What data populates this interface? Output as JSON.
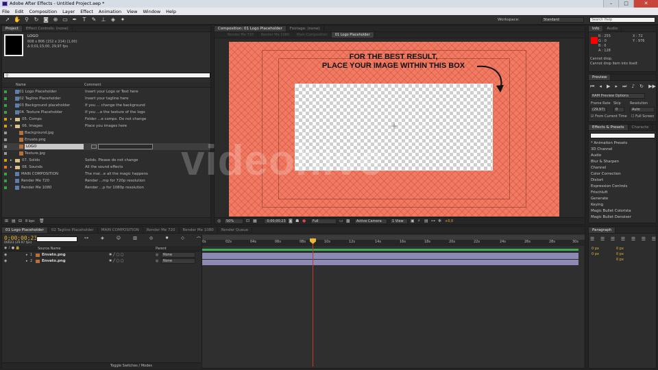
{
  "app": {
    "title": "Adobe After Effects - Untitled Project.aep *"
  },
  "menu": [
    "File",
    "Edit",
    "Composition",
    "Layer",
    "Effect",
    "Animation",
    "View",
    "Window",
    "Help"
  ],
  "workspace": {
    "label": "Workspace:",
    "value": "Standard"
  },
  "search_help": {
    "placeholder": "Search Help"
  },
  "project": {
    "tabs": [
      "Project",
      "Effect Controls: (none)"
    ],
    "item_name": "LOGO",
    "item_info1": "608 x 806 (152 x 214) (1,00)",
    "item_info2": "Δ 0;01;15;00, 29,97 fps",
    "col_name": "Name",
    "col_comment": "Comment",
    "items": [
      {
        "name": "01 Logo Placeholder",
        "comment": "Insert your Logo or Text here",
        "color": "#3aa34a"
      },
      {
        "name": "02 Tagline Placeholder",
        "comment": "Insert your tagline here",
        "color": "#3aa34a"
      },
      {
        "name": "03 Background placeholder",
        "comment": "If you ... change the background",
        "color": "#3aa34a"
      },
      {
        "name": "04. Texture Placeholder",
        "comment": "If you ...e the texture of the logo",
        "color": "#3aa34a"
      },
      {
        "name": "05. Comps",
        "comment": "Folder ...e comps. Do not change",
        "color": "#d4a017"
      },
      {
        "name": "06. Images",
        "comment": "Place you images here",
        "color": "#d4a017"
      },
      {
        "name": "Background.jpg",
        "comment": "",
        "color": "#9a9a9a"
      },
      {
        "name": "Envato.png",
        "comment": "",
        "color": "#9a9a9a"
      },
      {
        "name": "LOGO",
        "comment": "",
        "color": "#9a9a9a"
      },
      {
        "name": "Texture.jpg",
        "comment": "",
        "color": "#9a9a9a"
      },
      {
        "name": "07. Solids",
        "comment": "Solids. Please do not change",
        "color": "#d4a017"
      },
      {
        "name": "08. Sounds",
        "comment": "All the sound effects",
        "color": "#e07a20"
      },
      {
        "name": "MAIN COMPOSITION",
        "comment": "The mai...e all the magic happens",
        "color": "#3aa34a"
      },
      {
        "name": "Render Me 720",
        "comment": "Render ...mp for 720p resolution",
        "color": "#3aa34a"
      },
      {
        "name": "Render Me 1080",
        "comment": "Render ...p for 1080p resolution",
        "color": "#3aa34a"
      }
    ],
    "bpc": "8 bpc"
  },
  "comp": {
    "tabs": [
      "Composition: 01 Logo Placeholder",
      "Footage: (none)"
    ],
    "subtabs": [
      "Render Me 720",
      "Render Me 1080",
      "Main Composition",
      "01 Logo Placeholder"
    ],
    "note_line1": "FOR THE BEST RESULT,",
    "note_line2": "PLACE YOUR IMAGE WITHIN THIS BOX",
    "zoom": "50%",
    "timecode": "0;00;00;23",
    "quality": "Full",
    "camera": "Active Camera",
    "view": "1 View",
    "exposure": "+0,0",
    "watermark": "videohive"
  },
  "info": {
    "tabs": [
      "Info",
      "Audio"
    ],
    "r": "R : 255",
    "g": "G : 0",
    "b": "B : 0",
    "a": "A : 128",
    "x": "X : 72",
    "y": "Y : 976",
    "msg1": "Cannot drop.",
    "msg2": "Cannot drop item into itself.",
    "swatch": "#ff0000"
  },
  "preview": {
    "tab": "Preview",
    "ram": "RAM Preview Options",
    "frame_rate_label": "Frame Rate",
    "skip_label": "Skip",
    "resolution_label": "Resolution",
    "frame_rate": "(29,97)",
    "skip": "0",
    "resolution": "Auto",
    "from_current": "From Current Time",
    "full_screen": "Full Screen"
  },
  "effects": {
    "tabs": [
      "Effects & Presets",
      "Characte"
    ],
    "items": [
      "* Animation Presets",
      "3D Channel",
      "Audio",
      "Blur & Sharpen",
      "Channel",
      "Color Correction",
      "Distort",
      "Expression Controls",
      "Frischluft",
      "Generate",
      "Keying",
      "Magic Bullet Colorista",
      "Magic Bullet Denoiser"
    ]
  },
  "paragraph": {
    "tab": "Paragraph",
    "v1": "0 px",
    "v2": "0 px",
    "v3": "0 px",
    "v4": "0 px",
    "v5": "0 px"
  },
  "timeline": {
    "tabs": [
      "01 Logo Placeholder",
      "02 Tagline Placeholder",
      "MAIN COMPOSITION",
      "Render Me 720",
      "Render Me 1080",
      "Render Queue"
    ],
    "timecode": "0;00;00;23",
    "frame_info": "00023 (29.97 fps)",
    "col_source": "Source Name",
    "col_parent": "Parent",
    "layers": [
      {
        "num": "1",
        "name": "Envato.png",
        "parent": "None"
      },
      {
        "num": "2",
        "name": "Envato.png",
        "parent": "None"
      }
    ],
    "ticks": [
      "0s",
      "02s",
      "04s",
      "06s",
      "08s",
      "10s",
      "12s",
      "14s",
      "16s",
      "18s",
      "20s",
      "22s",
      "24s",
      "26s",
      "28s",
      "30s"
    ],
    "toggle_label": "Toggle Switches / Modes"
  }
}
